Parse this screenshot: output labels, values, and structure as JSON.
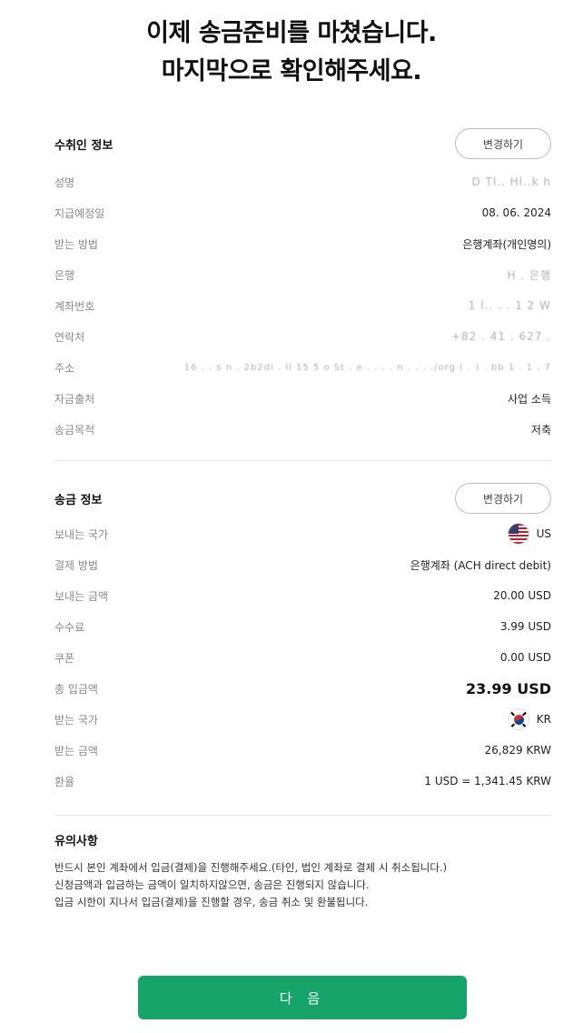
{
  "header": {
    "line1": "이제 송금준비를 마쳤습니다.",
    "line2": "마지막으로 확인해주세요."
  },
  "recipient": {
    "title": "수취인 정보",
    "change_label": "변경하기",
    "rows": [
      {
        "label": "성명",
        "value": "D Tl.. Hl..k h"
      },
      {
        "label": "지급예정일",
        "value": "08. 06. 2024"
      },
      {
        "label": "받는 방법",
        "value": "은행계좌(개인명의)"
      },
      {
        "label": "은행",
        "value": "H . 은행"
      },
      {
        "label": "계좌번호",
        "value": "1 l.. . . 1 2 W"
      },
      {
        "label": "연락처",
        "value": "+82 . 41 . 627 . "
      },
      {
        "label": "주소",
        "value": "16 . . s  n .  2b2dl . ll 15 5  o St . e . . .  . n . . . ./org ( . ) . bb 1 . 1 . 7"
      },
      {
        "label": "자금출처",
        "value": "사업 소득"
      },
      {
        "label": "송금목적",
        "value": "저축"
      }
    ]
  },
  "transfer": {
    "title": "송금 정보",
    "change_label": "변경하기",
    "send_country": {
      "label": "보내는 국가",
      "value": "US",
      "icon": "us-flag-icon"
    },
    "payment_method": {
      "label": "결제 방법",
      "value": "은행계좌 (ACH direct debit)"
    },
    "send_amount": {
      "label": "보내는 금액",
      "value": "20.00 USD"
    },
    "fee": {
      "label": "수수료",
      "value": "3.99 USD"
    },
    "coupon": {
      "label": "쿠폰",
      "value": "0.00 USD"
    },
    "total": {
      "label": "총 입금액",
      "value": "23.99 USD"
    },
    "receive_country": {
      "label": "받는 국가",
      "value": "KR",
      "icon": "kr-flag-icon"
    },
    "receive_amount": {
      "label": "받는 금액",
      "value": "26,829 KRW"
    },
    "rate": {
      "label": "환율",
      "value": "1 USD = 1,341.45 KRW"
    }
  },
  "notice": {
    "title": "유의사항",
    "lines": [
      "반드시 본인 계좌에서 입금(결제)을 진행해주세요.(타인, 법인 계좌로 결제 시 취소됩니다.)",
      "신청금액과 입금하는 금액이 일치하지않으면, 송금은 진행되지 않습니다.",
      "입금 시한이 지나서 입금(결제)을 진행할 경우, 송금 취소 및 환불됩니다."
    ]
  },
  "next_button": "다 음",
  "colors": {
    "accent": "#16a46a"
  }
}
